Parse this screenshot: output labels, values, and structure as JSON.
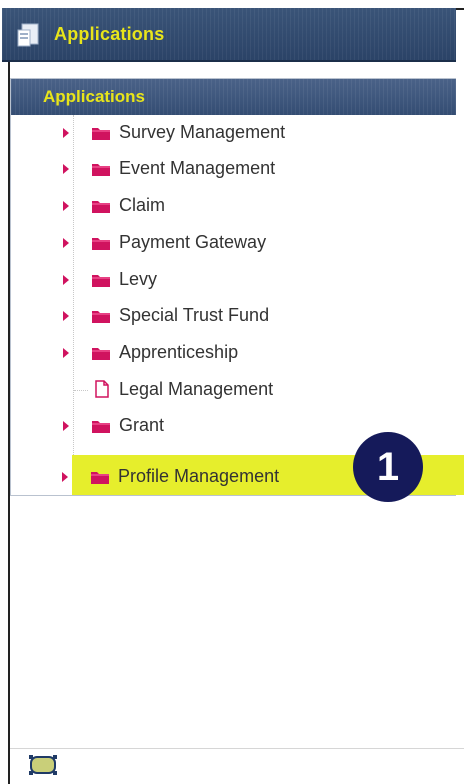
{
  "titlebar": {
    "title": "Applications",
    "icon": "app-window-icon"
  },
  "panel": {
    "header": "Applications",
    "items": [
      {
        "label": "Survey Management",
        "icon": "folder-icon",
        "expandable": true
      },
      {
        "label": "Event Management",
        "icon": "folder-icon",
        "expandable": true
      },
      {
        "label": "Claim",
        "icon": "folder-icon",
        "expandable": true
      },
      {
        "label": "Payment Gateway",
        "icon": "folder-icon",
        "expandable": true
      },
      {
        "label": "Levy",
        "icon": "folder-icon",
        "expandable": true
      },
      {
        "label": "Special Trust Fund",
        "icon": "folder-icon",
        "expandable": true
      },
      {
        "label": "Apprenticeship",
        "icon": "folder-icon",
        "expandable": true
      },
      {
        "label": "Legal Management",
        "icon": "document-icon",
        "expandable": false
      },
      {
        "label": "Grant",
        "icon": "folder-icon",
        "expandable": true
      },
      {
        "label": "Profile Management",
        "icon": "folder-icon",
        "expandable": true,
        "highlighted": true
      }
    ]
  },
  "annotation": {
    "step_number": "1"
  },
  "colors": {
    "header_bg": "#2b4367",
    "header_text": "#e8e51a",
    "accent_pink": "#d0135f",
    "highlight": "#e6ee2c",
    "badge_bg": "#151a5a"
  }
}
